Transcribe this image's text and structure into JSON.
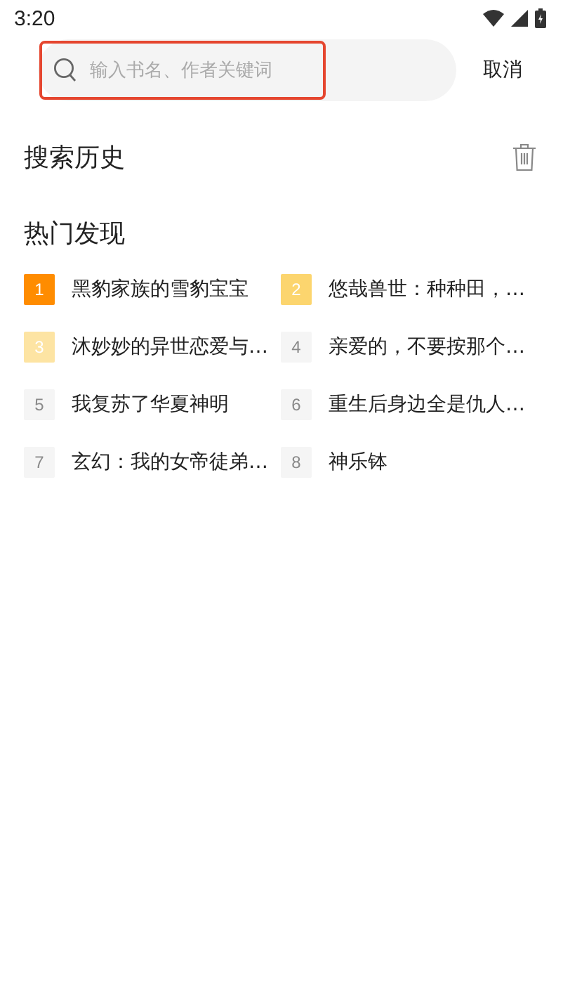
{
  "status_bar": {
    "time": "3:20"
  },
  "search": {
    "placeholder": "输入书名、作者关键词",
    "highlighted": true,
    "cancel": "取消"
  },
  "history": {
    "title": "搜索历史"
  },
  "hot": {
    "title": "热门发现",
    "items": [
      {
        "rank": "1",
        "title": "黑豹家族的雪豹宝宝",
        "color": "#ff8c00"
      },
      {
        "rank": "2",
        "title": "悠哉兽世：种种田，…",
        "color": "#fcd56e"
      },
      {
        "rank": "3",
        "title": "沐妙妙的异世恋爱与…",
        "color": "#fde4a3"
      },
      {
        "rank": "4",
        "title": "亲爱的，不要按那个…",
        "color": "#f5f5f5"
      },
      {
        "rank": "5",
        "title": "我复苏了华夏神明",
        "color": "#f5f5f5"
      },
      {
        "rank": "6",
        "title": "重生后身边全是仇人…",
        "color": "#f5f5f5"
      },
      {
        "rank": "7",
        "title": "玄幻：我的女帝徒弟…",
        "color": "#f5f5f5"
      },
      {
        "rank": "8",
        "title": "神乐钵",
        "color": "#f5f5f5"
      }
    ]
  }
}
